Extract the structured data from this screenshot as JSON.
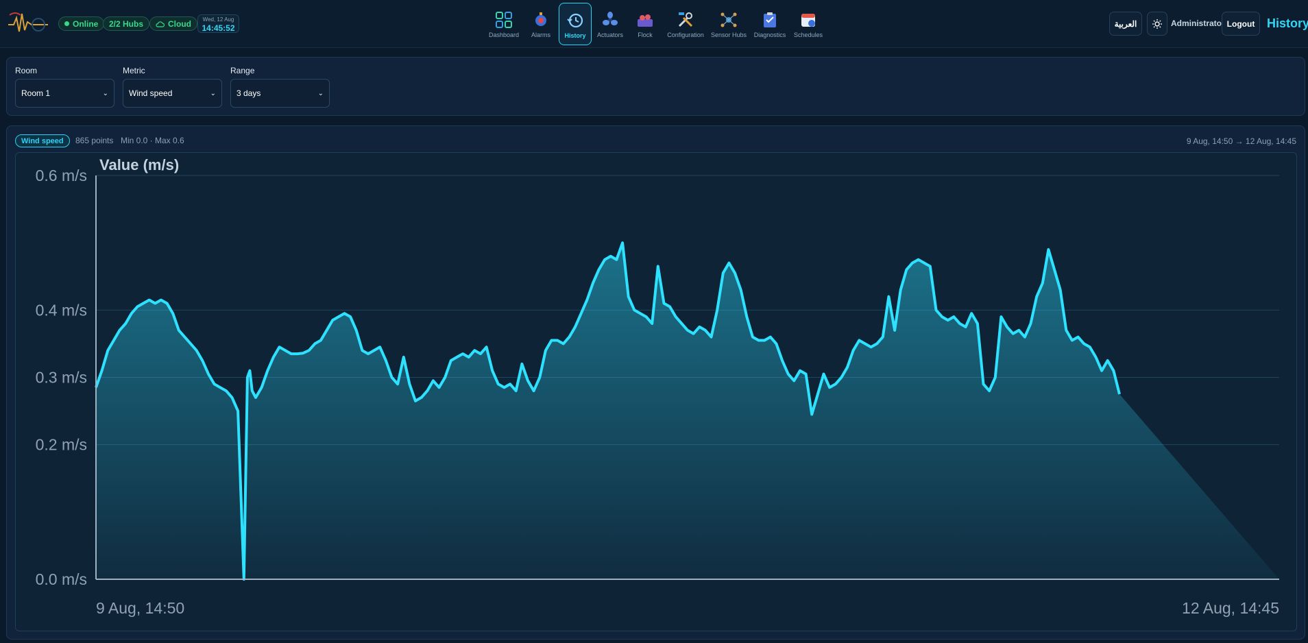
{
  "header": {
    "status_online": "Online",
    "hubs": "2/2 Hubs",
    "cloud": "Cloud",
    "date": "Wed, 12 Aug",
    "time": "14:45:52",
    "language_button": "العربية",
    "user": "Administrator",
    "logout": "Logout",
    "page_title": "History"
  },
  "nav": [
    {
      "label": "Dashboard",
      "icon": "dashboard-icon"
    },
    {
      "label": "Alarms",
      "icon": "alarm-icon"
    },
    {
      "label": "History",
      "icon": "history-icon",
      "active": true
    },
    {
      "label": "Actuators",
      "icon": "fan-icon"
    },
    {
      "label": "Flock",
      "icon": "flock-icon"
    },
    {
      "label": "Configuration",
      "icon": "tools-icon"
    },
    {
      "label": "Sensor Hubs",
      "icon": "sensor-hub-icon"
    },
    {
      "label": "Diagnostics",
      "icon": "clipboard-icon"
    },
    {
      "label": "Schedules",
      "icon": "calendar-icon"
    }
  ],
  "filters": {
    "room_label": "Room",
    "room_value": "Room 1",
    "metric_label": "Metric",
    "metric_value": "Wind speed",
    "range_label": "Range",
    "range_value": "3 days"
  },
  "chart_summary": {
    "badge": "Wind speed",
    "points": "865 points",
    "minmax": "Min 0.0 · Max 0.6",
    "range": "9 Aug, 14:50 → 12 Aug, 14:45"
  },
  "colors": {
    "accent": "#2ad3f2",
    "online": "#39d98a",
    "background": "#0b1a2b"
  },
  "chart_data": {
    "type": "area",
    "title": "Value (m/s)",
    "ylim": [
      0.0,
      0.6
    ],
    "yticks": [
      "0.0 m/s",
      "0.2 m/s",
      "0.3 m/s",
      "0.4 m/s",
      "0.6 m/s"
    ],
    "xticks": [
      "9 Aug, 14:50",
      "12 Aug, 14:45"
    ],
    "grid": true,
    "series": [
      {
        "x_fraction": [
          0,
          0.005,
          0.01,
          0.015,
          0.02,
          0.025,
          0.03,
          0.035,
          0.04,
          0.045,
          0.05,
          0.055,
          0.06,
          0.065,
          0.07,
          0.075,
          0.08,
          0.085,
          0.09,
          0.095,
          0.1,
          0.105,
          0.11,
          0.115,
          0.12,
          0.125,
          0.128,
          0.13,
          0.132,
          0.135,
          0.14,
          0.145,
          0.15,
          0.155,
          0.16,
          0.165,
          0.17,
          0.175,
          0.18,
          0.185,
          0.19,
          0.195,
          0.2,
          0.205,
          0.21,
          0.215,
          0.22,
          0.225,
          0.23,
          0.235,
          0.24,
          0.245,
          0.25,
          0.255,
          0.26,
          0.265,
          0.27,
          0.275,
          0.28,
          0.285,
          0.29,
          0.295,
          0.3,
          0.305,
          0.31,
          0.315,
          0.32,
          0.325,
          0.33,
          0.335,
          0.34,
          0.345,
          0.35,
          0.355,
          0.36,
          0.365,
          0.37,
          0.375,
          0.38,
          0.385,
          0.39,
          0.395,
          0.4,
          0.405,
          0.41,
          0.415,
          0.42,
          0.425,
          0.43,
          0.435,
          0.44,
          0.445,
          0.45,
          0.455,
          0.46,
          0.465,
          0.47,
          0.475,
          0.48,
          0.485,
          0.49,
          0.495,
          0.5,
          0.505,
          0.51,
          0.515,
          0.52,
          0.525,
          0.53,
          0.535,
          0.54,
          0.545,
          0.55,
          0.555,
          0.56,
          0.565,
          0.57,
          0.575,
          0.58,
          0.585,
          0.59,
          0.595,
          0.6,
          0.605,
          0.61,
          0.615,
          0.62,
          0.625,
          0.63,
          0.635,
          0.64,
          0.645,
          0.65,
          0.655,
          0.66,
          0.665,
          0.67,
          0.675,
          0.68,
          0.685,
          0.69,
          0.695,
          0.7,
          0.705,
          0.71,
          0.715,
          0.72,
          0.725,
          0.73,
          0.735,
          0.74,
          0.745,
          0.75,
          0.755,
          0.76,
          0.765,
          0.77,
          0.775,
          0.78,
          0.785,
          0.79,
          0.795,
          0.8,
          0.805,
          0.81,
          0.815,
          0.82,
          0.825,
          0.83,
          0.835,
          0.84,
          0.845,
          0.85,
          0.855,
          0.86,
          0.865,
          0.87,
          0.875,
          0.88,
          0.885,
          0.89,
          0.895,
          0.9,
          0.905,
          0.91,
          0.915,
          0.92,
          0.925,
          0.93,
          0.935,
          0.94,
          0.945,
          0.95,
          0.955,
          0.96,
          0.965,
          0.97,
          0.975,
          0.98,
          0.985,
          0.99,
          0.995,
          1.0
        ],
        "values": [
          0.285,
          0.31,
          0.34,
          0.355,
          0.37,
          0.38,
          0.395,
          0.405,
          0.41,
          0.415,
          0.41,
          0.415,
          0.41,
          0.395,
          0.37,
          0.36,
          0.35,
          0.34,
          0.325,
          0.305,
          0.29,
          0.285,
          0.28,
          0.27,
          0.25,
          0.0,
          0.3,
          0.31,
          0.28,
          0.27,
          0.285,
          0.31,
          0.33,
          0.345,
          0.34,
          0.335,
          0.335,
          0.336,
          0.34,
          0.35,
          0.355,
          0.37,
          0.385,
          0.39,
          0.395,
          0.39,
          0.37,
          0.34,
          0.335,
          0.34,
          0.345,
          0.325,
          0.3,
          0.29,
          0.33,
          0.29,
          0.265,
          0.27,
          0.28,
          0.295,
          0.285,
          0.3,
          0.325,
          0.33,
          0.335,
          0.33,
          0.34,
          0.335,
          0.345,
          0.31,
          0.29,
          0.285,
          0.29,
          0.28,
          0.32,
          0.295,
          0.28,
          0.3,
          0.34,
          0.355,
          0.355,
          0.35,
          0.36,
          0.375,
          0.395,
          0.415,
          0.44,
          0.46,
          0.475,
          0.48,
          0.475,
          0.5,
          0.42,
          0.4,
          0.395,
          0.39,
          0.38,
          0.465,
          0.41,
          0.405,
          0.39,
          0.38,
          0.37,
          0.365,
          0.375,
          0.37,
          0.36,
          0.4,
          0.455,
          0.47,
          0.455,
          0.43,
          0.39,
          0.36,
          0.355,
          0.355,
          0.36,
          0.35,
          0.325,
          0.305,
          0.295,
          0.31,
          0.305,
          0.245,
          0.275,
          0.305,
          0.285,
          0.29,
          0.3,
          0.315,
          0.34,
          0.355,
          0.35,
          0.345,
          0.35,
          0.36,
          0.42,
          0.37,
          0.43,
          0.46,
          0.47,
          0.475,
          0.47,
          0.465,
          0.4,
          0.39,
          0.385,
          0.39,
          0.38,
          0.375,
          0.395,
          0.38,
          0.29,
          0.28,
          0.3,
          0.39,
          0.375,
          0.365,
          0.37,
          0.36,
          0.38,
          0.42,
          0.44,
          0.49,
          0.46,
          0.43,
          0.37,
          0.355,
          0.36,
          0.35,
          0.345,
          0.33,
          0.31,
          0.325,
          0.31,
          0.275
        ]
      }
    ]
  }
}
